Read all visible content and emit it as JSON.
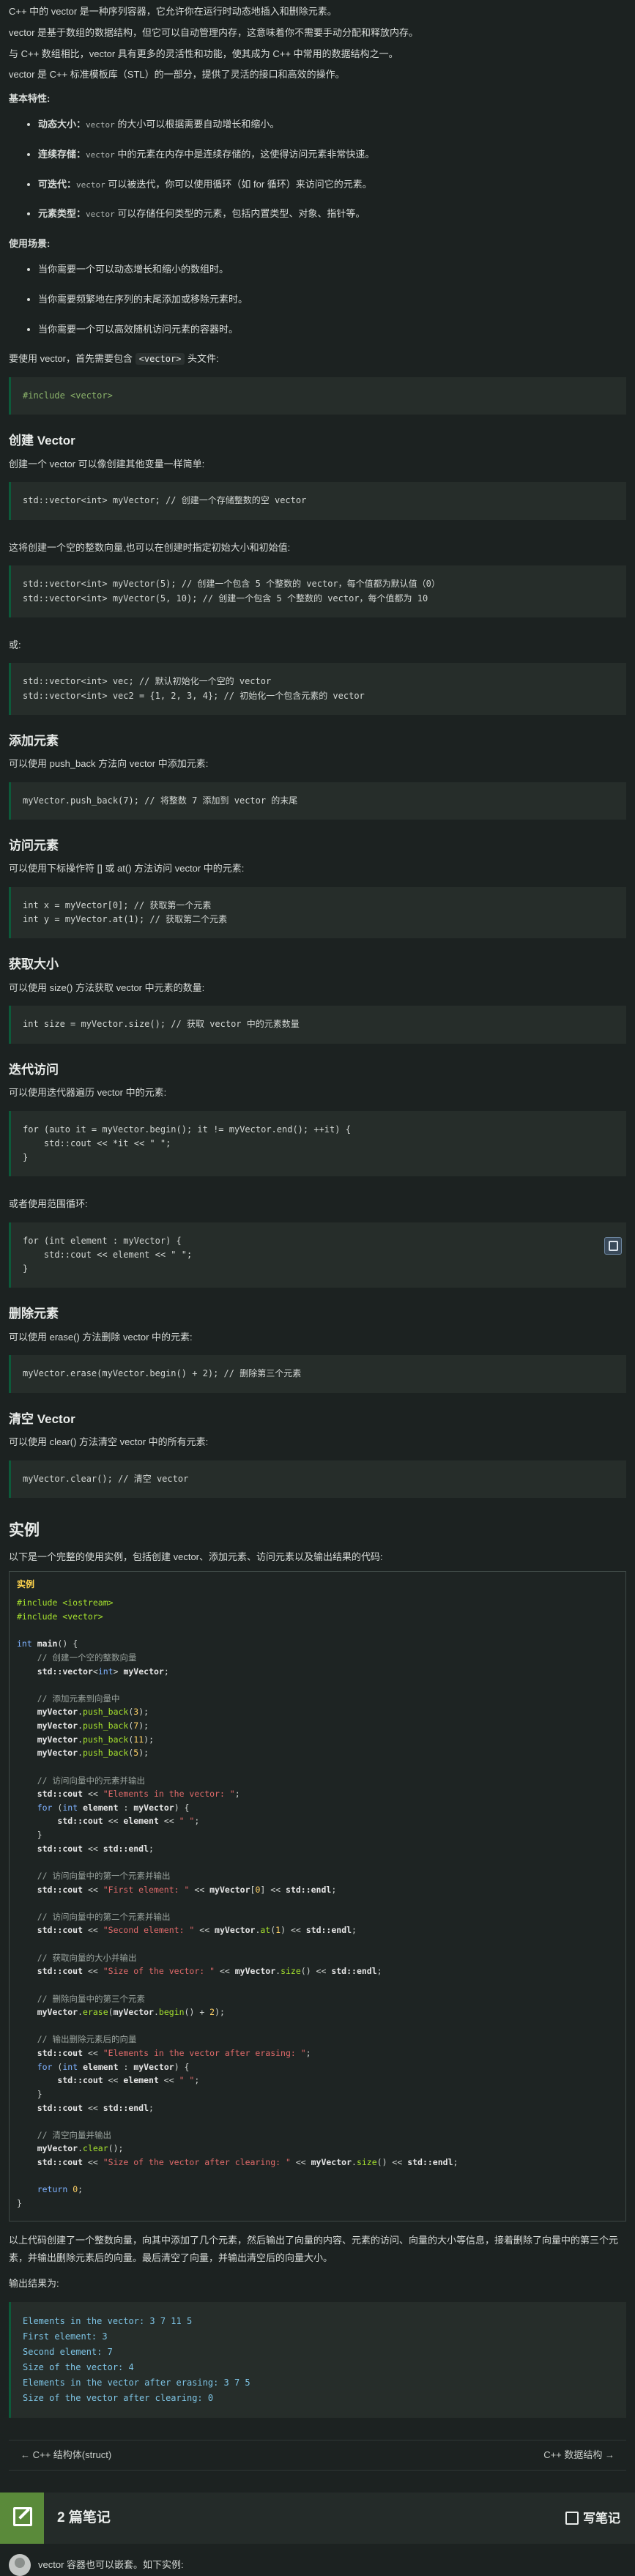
{
  "intro": [
    "C++ 中的 vector 是一种序列容器，它允许你在运行时动态地插入和删除元素。",
    "vector 是基于数组的数据结构，但它可以自动管理内存，这意味着你不需要手动分配和释放内存。",
    "与 C++ 数组相比，vector 具有更多的灵活性和功能，使其成为 C++ 中常用的数据结构之一。",
    "vector 是 C++ 标准模板库（STL）的一部分，提供了灵活的接口和高效的操作。"
  ],
  "features_heading": "基本特性:",
  "features": [
    {
      "name": "动态大小：",
      "code": "vector",
      "text": " 的大小可以根据需要自动增长和缩小。"
    },
    {
      "name": "连续存储：",
      "code": "vector",
      "text": " 中的元素在内存中是连续存储的，这使得访问元素非常快速。"
    },
    {
      "name": "可迭代：",
      "code": "vector",
      "text": " 可以被迭代，你可以使用循环（如 for 循环）来访问它的元素。"
    },
    {
      "name": "元素类型：",
      "code": "vector",
      "text": " 可以存储任何类型的元素，包括内置类型、对象、指针等。"
    }
  ],
  "use_heading": "使用场景:",
  "use_cases": [
    "当你需要一个可以动态增长和缩小的数组时。",
    "当你需要频繁地在序列的末尾添加或移除元素时。",
    "当你需要一个可以高效随机访问元素的容器时。"
  ],
  "include_text_pre": "要使用 vector，首先需要包含 ",
  "include_text_code": "<vector>",
  "include_text_post": " 头文件:",
  "include_code": "#include <vector>",
  "h_create": "创建 Vector",
  "create_text": "创建一个 vector 可以像创建其他变量一样简单:",
  "create_code": "std::vector<int> myVector; // 创建一个存储整数的空 vector",
  "create_text2": "这将创建一个空的整数向量,也可以在创建时指定初始大小和初始值:",
  "create_code2": "std::vector<int> myVector(5); // 创建一个包含 5 个整数的 vector，每个值都为默认值（0）\nstd::vector<int> myVector(5, 10); // 创建一个包含 5 个整数的 vector，每个值都为 10",
  "or_text": "或:",
  "create_code3": "std::vector<int> vec; // 默认初始化一个空的 vector\nstd::vector<int> vec2 = {1, 2, 3, 4}; // 初始化一个包含元素的 vector",
  "h_add": "添加元素",
  "add_text": "可以使用 push_back 方法向 vector 中添加元素:",
  "add_code": "myVector.push_back(7); // 将整数 7 添加到 vector 的末尾",
  "h_access": "访问元素",
  "access_text": "可以使用下标操作符 [] 或 at() 方法访问 vector 中的元素:",
  "access_code": "int x = myVector[0]; // 获取第一个元素\nint y = myVector.at(1); // 获取第二个元素",
  "h_size": "获取大小",
  "size_text": "可以使用 size() 方法获取 vector 中元素的数量:",
  "size_code": "int size = myVector.size(); // 获取 vector 中的元素数量",
  "h_iter": "迭代访问",
  "iter_text": "可以使用迭代器遍历 vector 中的元素:",
  "iter_code": "for (auto it = myVector.begin(); it != myVector.end(); ++it) {\n    std::cout << *it << \" \";\n}",
  "range_text": "或者使用范围循环:",
  "range_code": "for (int element : myVector) {\n    std::cout << element << \" \";\n}",
  "h_erase": "删除元素",
  "erase_text": "可以使用 erase() 方法删除 vector 中的元素:",
  "erase_code": "myVector.erase(myVector.begin() + 2); // 删除第三个元素",
  "h_clear": "清空 Vector",
  "clear_text": "可以使用 clear() 方法清空 vector 中的所有元素:",
  "clear_code": "myVector.clear(); // 清空 vector",
  "h_example": "实例",
  "example_text": "以下是一个完整的使用实例，包括创建 vector、添加元素、访问元素以及输出结果的代码:",
  "example_label": "实例",
  "example_after": "以上代码创建了一个整数向量，向其中添加了几个元素，然后输出了向量的内容、元素的访问、向量的大小等信息，接着删除了向量中的第三个元素，并输出删除元素后的向量。最后清空了向量，并输出清空后的向量大小。",
  "output_text": "输出结果为:",
  "output_code": "Elements in the vector: 3 7 11 5\nFirst element: 3\nSecond element: 7\nSize of the vector: 4\nElements in the vector after erasing: 3 7 5\nSize of the vector after clearing: 0",
  "nav": {
    "prev": "← C++ 结构体(struct)",
    "next": "C++ 数据结构 →"
  },
  "notes": {
    "count": "2 篇笔记",
    "write": "写笔记"
  },
  "comment_text": "vector 容器也可以嵌套。如下实例:"
}
